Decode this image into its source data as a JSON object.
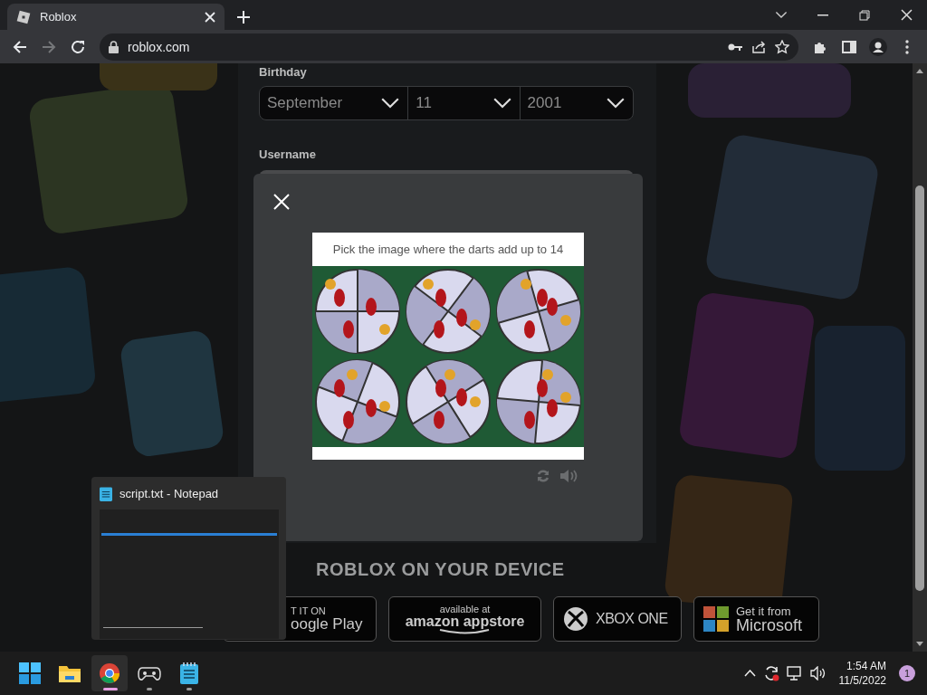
{
  "browser": {
    "tab_title": "Roblox",
    "address": "roblox.com",
    "forward_disabled": true
  },
  "form": {
    "birthday_label": "Birthday",
    "selects": [
      {
        "value": "September"
      },
      {
        "value": "11"
      },
      {
        "value": "2001"
      }
    ],
    "username_label": "Username"
  },
  "captcha": {
    "prompt": "Pick the image where the darts add up to 14"
  },
  "device_section": {
    "heading": "ROBLOX ON YOUR DEVICE",
    "badges": [
      {
        "kind": "google",
        "line1": "T IT ON",
        "line2": "oogle Play"
      },
      {
        "kind": "amazon",
        "line1": "available at",
        "line2": "amazon appstore"
      },
      {
        "kind": "xbox",
        "line1": "XBOX ONE"
      },
      {
        "kind": "microsoft",
        "line1": "Get it from",
        "line2": "Microsoft"
      }
    ]
  },
  "taskbar_preview": {
    "title": "script.txt - Notepad"
  },
  "taskbar": {
    "apps": [
      {
        "kind": "start",
        "running": false,
        "selected": false
      },
      {
        "kind": "explorer",
        "running": false,
        "selected": false
      },
      {
        "kind": "chrome",
        "running": true,
        "selected": true
      },
      {
        "kind": "game",
        "running": true,
        "selected": false
      },
      {
        "kind": "notepad",
        "running": true,
        "selected": false
      }
    ],
    "time": "1:54 AM",
    "date": "11/5/2022",
    "notifications": "1"
  }
}
